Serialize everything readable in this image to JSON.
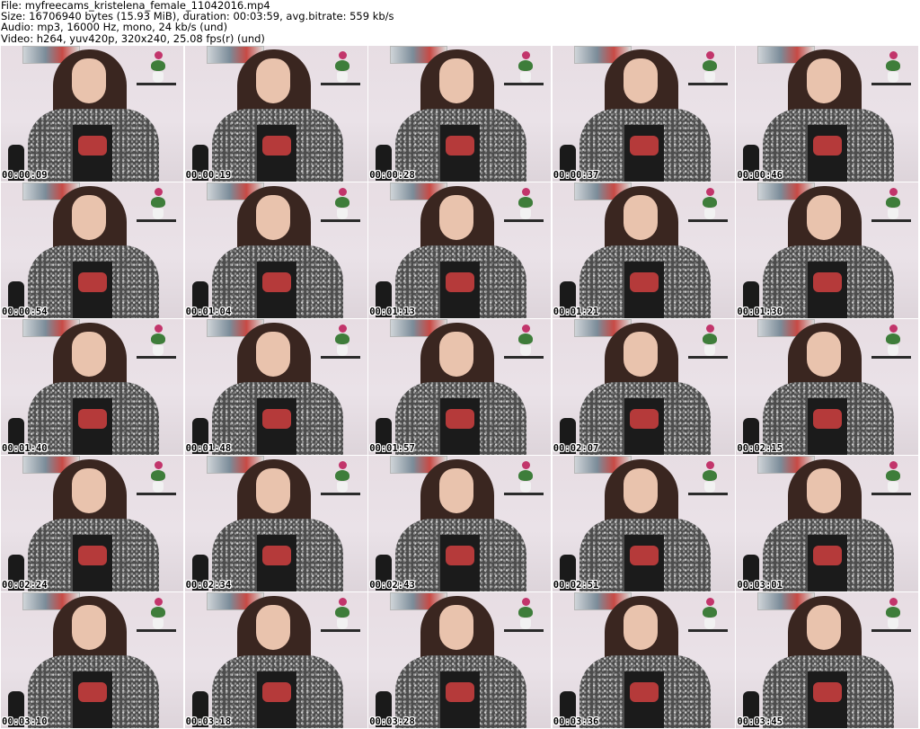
{
  "header": {
    "file_line": "File: myfreecams_kristelena_female_11042016.mp4",
    "size_line": "Size: 16706940 bytes (15.93 MiB), duration: 00:03:59, avg.bitrate: 559 kb/s",
    "audio_line": "Audio: mp3, 16000 Hz, mono, 24 kb/s (und)",
    "video_line": "Video: h264, yuv420p, 320x240, 25.08 fps(r) (und)"
  },
  "thumbnails": [
    {
      "timestamp": "00:00:09"
    },
    {
      "timestamp": "00:00:19"
    },
    {
      "timestamp": "00:00:28"
    },
    {
      "timestamp": "00:00:37"
    },
    {
      "timestamp": "00:00:46"
    },
    {
      "timestamp": "00:00:54"
    },
    {
      "timestamp": "00:01:04"
    },
    {
      "timestamp": "00:01:13"
    },
    {
      "timestamp": "00:01:21"
    },
    {
      "timestamp": "00:01:30"
    },
    {
      "timestamp": "00:01:40"
    },
    {
      "timestamp": "00:01:48"
    },
    {
      "timestamp": "00:01:57"
    },
    {
      "timestamp": "00:02:07"
    },
    {
      "timestamp": "00:02:15"
    },
    {
      "timestamp": "00:02:24"
    },
    {
      "timestamp": "00:02:34"
    },
    {
      "timestamp": "00:02:43"
    },
    {
      "timestamp": "00:02:51"
    },
    {
      "timestamp": "00:03:01"
    },
    {
      "timestamp": "00:03:10"
    },
    {
      "timestamp": "00:03:18"
    },
    {
      "timestamp": "00:03:28"
    },
    {
      "timestamp": "00:03:36"
    },
    {
      "timestamp": "00:03:45"
    }
  ]
}
